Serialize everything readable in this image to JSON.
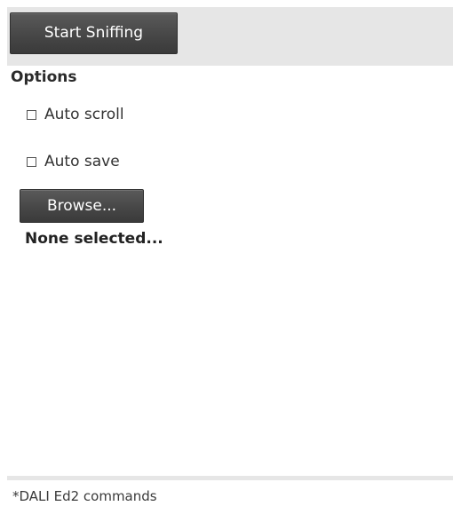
{
  "toolbar": {
    "start_label": "Start Sniffing"
  },
  "options": {
    "title": "Options",
    "auto_scroll": {
      "label": "Auto scroll",
      "checked": false
    },
    "auto_save": {
      "label": "Auto save",
      "checked": false
    },
    "browse_label": "Browse...",
    "file_status": "None selected..."
  },
  "footer": {
    "note": "*DALI Ed2 commands"
  },
  "colors": {
    "toolbar_bg": "#e6e6e6",
    "button_bg": "#474747",
    "button_text": "#ffffff"
  }
}
